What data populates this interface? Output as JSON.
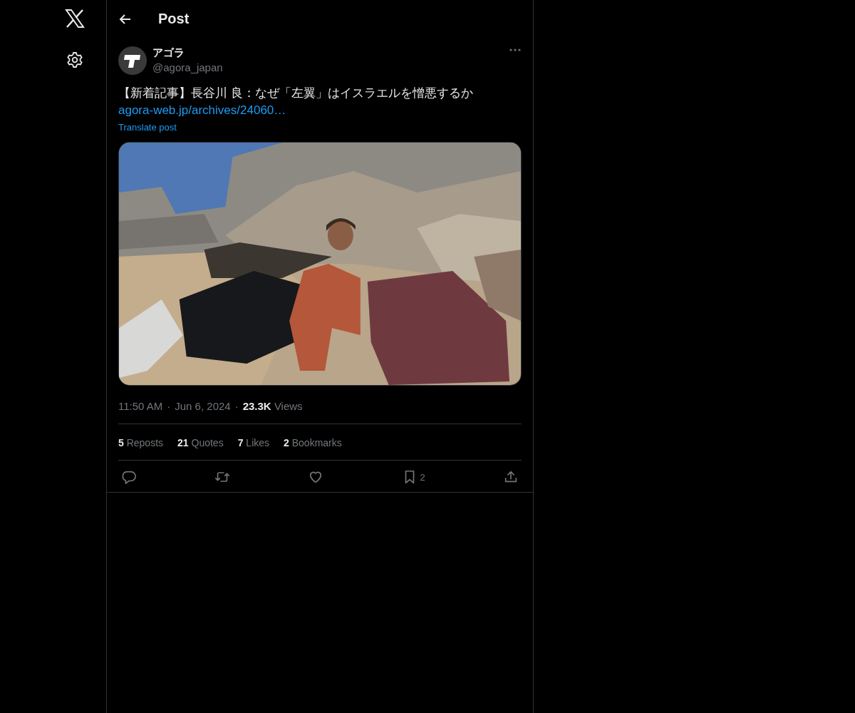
{
  "header": {
    "title": "Post"
  },
  "post": {
    "author": "アゴラ",
    "handle": "@agora_japan",
    "text": "【新着記事】長谷川 良：なぜ「左翼」はイスラエルを憎悪するか",
    "link": "agora-web.jp/archives/24060…",
    "translate": "Translate post",
    "time": "11:50 AM",
    "separator": "·",
    "date": "Jun 6, 2024",
    "views_count": "23.3K",
    "views_label": "Views"
  },
  "stats": [
    {
      "count": "5",
      "label": "Reposts"
    },
    {
      "count": "21",
      "label": "Quotes"
    },
    {
      "count": "7",
      "label": "Likes"
    },
    {
      "count": "2",
      "label": "Bookmarks"
    }
  ],
  "actions": [
    {
      "kind": "reply"
    },
    {
      "kind": "repost"
    },
    {
      "kind": "like"
    },
    {
      "kind": "bookmark",
      "count": "2"
    },
    {
      "kind": "share"
    }
  ]
}
